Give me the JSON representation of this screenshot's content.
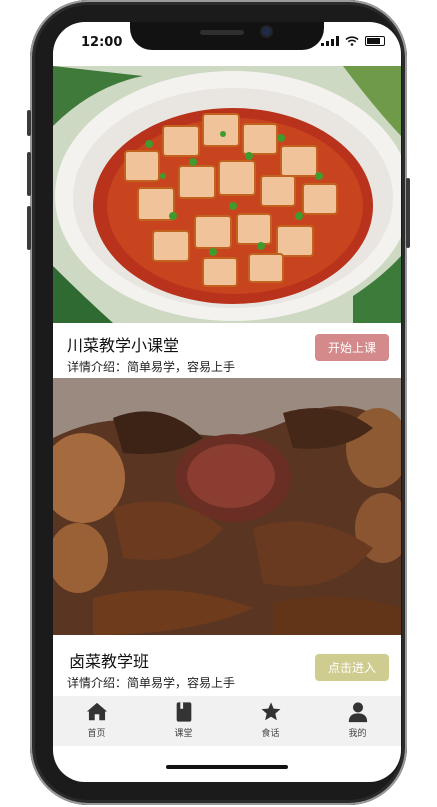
{
  "status_bar": {
    "time": "12:00"
  },
  "courses": [
    {
      "title": "川菜教学小课堂",
      "description": "详情介绍：简单易学，容易上手",
      "button_label": "开始上课",
      "button_color": "#d4898b",
      "image": "mapo-tofu-photo"
    },
    {
      "title": "卤菜教学班",
      "description": "详情介绍：简单易学，容易上手",
      "button_label": "点击进入",
      "button_color": "#cfcc8f",
      "image": "braised-meat-photo"
    }
  ],
  "tab_bar": [
    {
      "label": "首页",
      "icon": "home-icon"
    },
    {
      "label": "课堂",
      "icon": "book-icon"
    },
    {
      "label": "食话",
      "icon": "star-icon"
    },
    {
      "label": "我的",
      "icon": "user-icon"
    }
  ]
}
